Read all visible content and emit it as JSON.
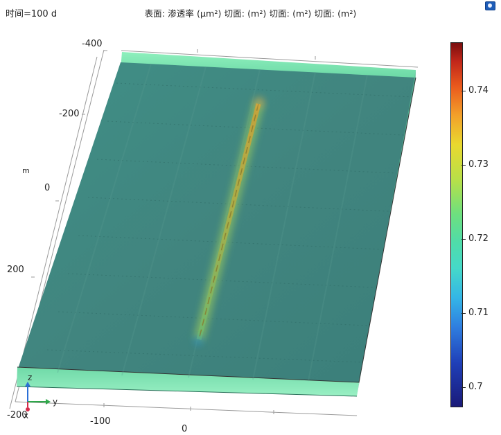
{
  "header": {
    "time_label": "时间=100 d",
    "title": "表面: 渗透率 (μm²)  切面:  (m²)  切面:  (m²)  切面:  (m²)"
  },
  "axes": {
    "unit": "m",
    "x_ticks": [
      "-400",
      "-200",
      "0",
      "200",
      "-200"
    ],
    "y_ticks": [
      "-100",
      "0"
    ],
    "triad": {
      "z": "z",
      "y": "y",
      "x": "x"
    }
  },
  "colorbar": {
    "ticks": [
      "0.74",
      "0.73",
      "0.72",
      "0.71",
      "0.7"
    ],
    "values": [
      0.74,
      0.73,
      0.72,
      0.71,
      0.7
    ],
    "range": [
      0.6975,
      0.7465
    ]
  },
  "icons": {
    "corner": "view-toggle-icon"
  }
}
